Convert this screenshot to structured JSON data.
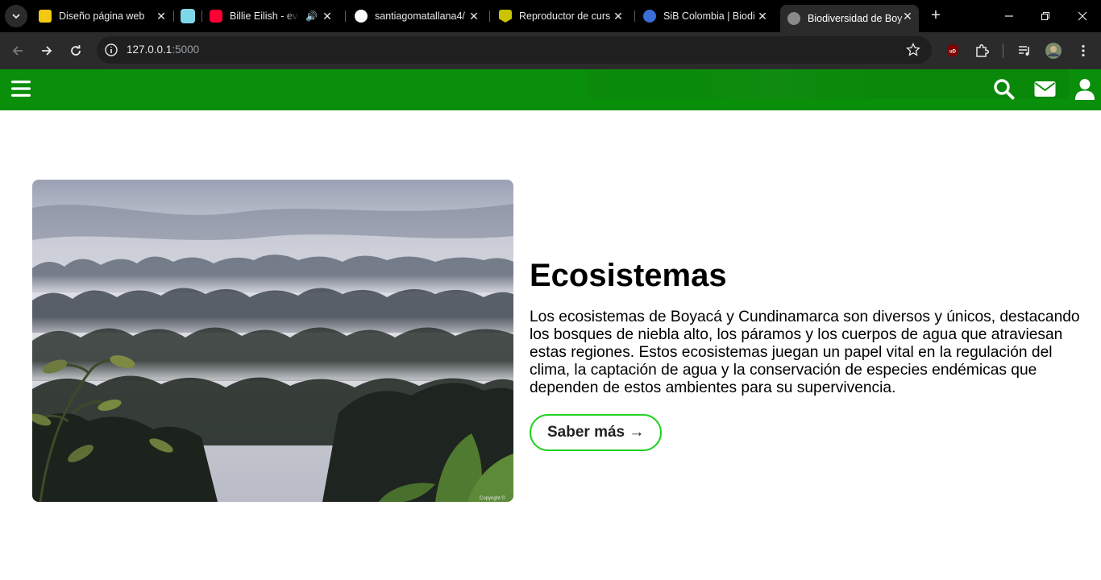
{
  "browser": {
    "tabs": [
      {
        "title": "Diseño página web",
        "favicon_color": "#f2c811"
      },
      {
        "title": "",
        "favicon_color": "#7fd8ea"
      },
      {
        "title": "Billie Eilish - ever",
        "favicon_color": "#ff0033"
      },
      {
        "title": "santiagomatallana4/",
        "favicon_color": "#ffffff"
      },
      {
        "title": "Reproductor de curs",
        "favicon_color": "#c9c300"
      },
      {
        "title": "SiB Colombia | Biodi",
        "favicon_color": "#3a6fd8"
      },
      {
        "title": "Biodiversidad de Boy",
        "favicon_color": "#8a8a8a"
      }
    ],
    "url_host": "127.0.0.1",
    "url_port": ":5000"
  },
  "site": {
    "header_color": "#098f09",
    "accent_color": "#1fd11f"
  },
  "section": {
    "title": "Ecosistemas",
    "description": "Los ecosistemas de Boyacá y Cundinamarca son diversos y únicos, destacando los bosques de niebla alto, los páramos y los cuerpos de agua que atraviesan estas regiones. Estos ecosistemas juegan un papel vital en la regulación del clima, la captación de agua y la conservación de especies endémicas que dependen de estos ambientes para su supervivencia.",
    "button_label": "Saber más →",
    "image_caption": "Copyright ©"
  }
}
